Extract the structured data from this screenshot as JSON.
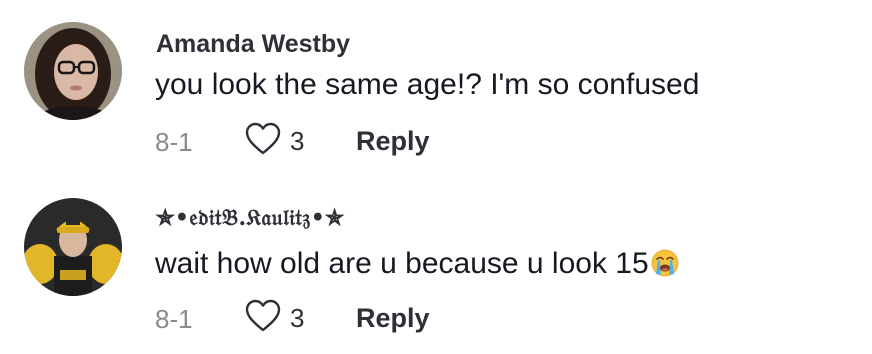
{
  "comments": [
    {
      "username": "Amanda Westby",
      "text": "you look the same age!? I'm so confused",
      "date": "8-1",
      "likes": "3",
      "reply_label": "Reply",
      "avatar_icon": "profile-photo-woman-glasses"
    },
    {
      "username": "✯•𝔢𝔡𝔦𝔱𝔅.𝔎𝔞𝔲𝔩𝔦𝔱𝔷•✯",
      "text": "wait how old are u because u look 15",
      "emoji_icon": "loudly-crying-face-icon",
      "date": "8-1",
      "likes": "3",
      "reply_label": "Reply",
      "avatar_icon": "profile-photo-yellow-cap"
    }
  ],
  "colors": {
    "text_primary": "#161823",
    "username": "#2f2f37",
    "meta_gray": "#8a8b91",
    "heart_stroke": "#2f2f37"
  }
}
